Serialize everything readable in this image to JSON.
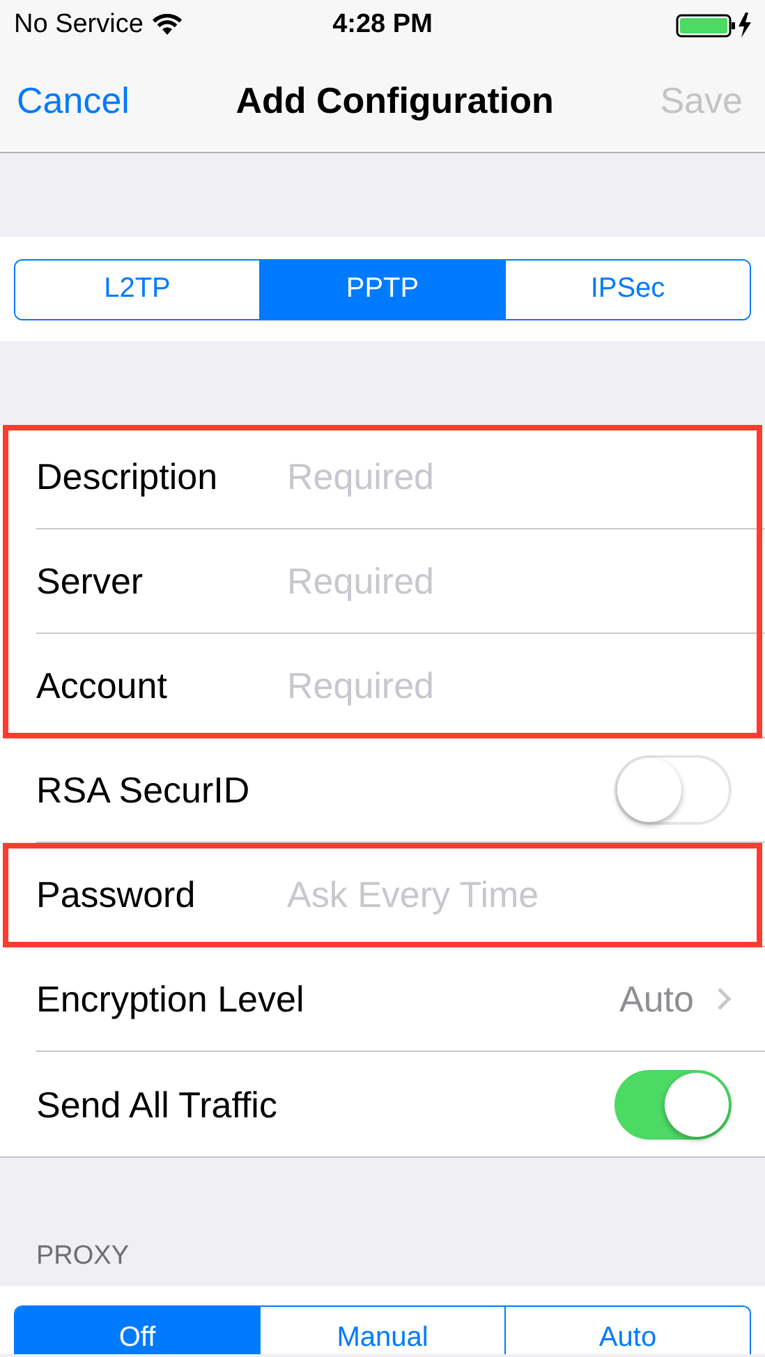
{
  "status_bar": {
    "carrier": "No Service",
    "time": "4:28 PM"
  },
  "nav": {
    "cancel": "Cancel",
    "title": "Add Configuration",
    "save": "Save",
    "save_disabled": true
  },
  "type_segments": [
    {
      "label": "L2TP",
      "selected": false
    },
    {
      "label": "PPTP",
      "selected": true
    },
    {
      "label": "IPSec",
      "selected": false
    }
  ],
  "groups": [
    {
      "highlighted": true,
      "rows": [
        {
          "kind": "field",
          "label": "Description",
          "placeholder": "Required"
        },
        {
          "kind": "field",
          "label": "Server",
          "placeholder": "Required"
        },
        {
          "kind": "field",
          "label": "Account",
          "placeholder": "Required"
        }
      ]
    },
    {
      "highlighted": false,
      "rows": [
        {
          "kind": "toggle",
          "label": "RSA SecurID",
          "on": false
        }
      ]
    },
    {
      "highlighted": true,
      "rows": [
        {
          "kind": "field",
          "label": "Password",
          "placeholder": "Ask Every Time"
        }
      ]
    },
    {
      "highlighted": false,
      "rows": [
        {
          "kind": "value",
          "label": "Encryption Level",
          "value": "Auto"
        },
        {
          "kind": "toggle",
          "label": "Send All Traffic",
          "on": true
        }
      ]
    }
  ],
  "proxy": {
    "header": "PROXY",
    "segments": [
      {
        "label": "Off",
        "selected": true
      },
      {
        "label": "Manual",
        "selected": false
      },
      {
        "label": "Auto",
        "selected": false
      }
    ]
  }
}
